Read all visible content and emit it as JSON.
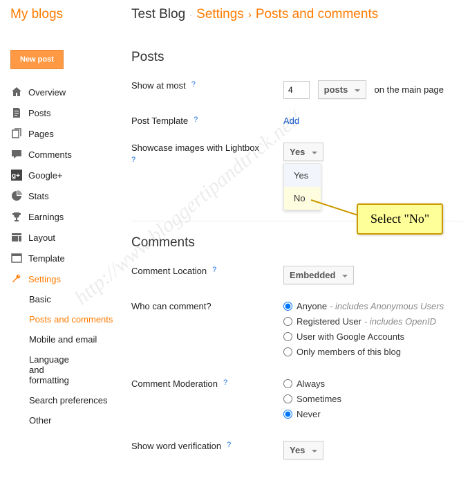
{
  "brand": "My blogs",
  "new_post": "New post",
  "nav": [
    {
      "label": "Overview"
    },
    {
      "label": "Posts"
    },
    {
      "label": "Pages"
    },
    {
      "label": "Comments"
    },
    {
      "label": "Google+"
    },
    {
      "label": "Stats"
    },
    {
      "label": "Earnings"
    },
    {
      "label": "Layout"
    },
    {
      "label": "Template"
    },
    {
      "label": "Settings"
    }
  ],
  "subnav": [
    {
      "label": "Basic"
    },
    {
      "label": "Posts and comments"
    },
    {
      "label": "Mobile and email"
    },
    {
      "label": "Language and formatting"
    },
    {
      "label": "Search preferences"
    },
    {
      "label": "Other"
    }
  ],
  "breadcrumb": {
    "blog": "Test Blog",
    "settings": "Settings",
    "page": "Posts and comments"
  },
  "sections": {
    "posts": "Posts",
    "comments": "Comments"
  },
  "fields": {
    "show_at_most": "Show at most",
    "show_value": "4",
    "show_unit": "posts",
    "show_trail": "on the main page",
    "post_template": "Post Template",
    "add": "Add",
    "lightbox": "Showcase images with Lightbox",
    "lightbox_val": "Yes",
    "lightbox_opt_yes": "Yes",
    "lightbox_opt_no": "No",
    "comment_location": "Comment Location",
    "comment_location_val": "Embedded",
    "who_comment": "Who can comment?",
    "who_opts": {
      "anyone": "Anyone",
      "anyone_note": " - includes Anonymous Users",
      "reg": "Registered User",
      "reg_note": " - includes OpenID",
      "google": "User with Google Accounts",
      "members": "Only members of this blog"
    },
    "moderation": "Comment Moderation",
    "moderation_opts": {
      "always": "Always",
      "sometimes": "Sometimes",
      "never": "Never"
    },
    "word_verify": "Show word verification",
    "word_verify_val": "Yes"
  },
  "callout": "Select \"No\"",
  "watermark": "http://www.bloggertipandtrick.net/"
}
